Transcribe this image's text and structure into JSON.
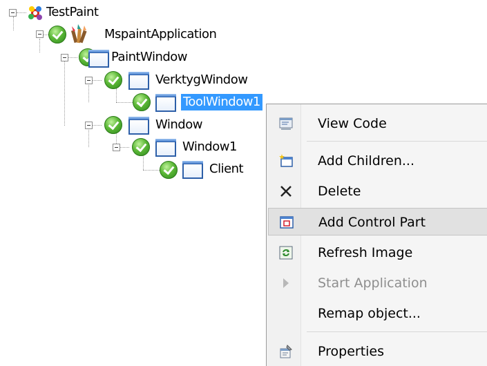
{
  "tree": {
    "root": "TestPaint",
    "app": "MspaintApplication",
    "paint_window": "PaintWindow",
    "verktyg_window": "VerktygWindow",
    "tool_window": "ToolWindow1",
    "window": "Window",
    "window1": "Window1",
    "client": "Client"
  },
  "menu": {
    "view_code": "View Code",
    "add_children": "Add Children...",
    "delete": "Delete",
    "add_control_part": "Add Control Part",
    "refresh_image": "Refresh Image",
    "start_application": "Start Application",
    "remap_object": "Remap object...",
    "properties": "Properties"
  },
  "colors": {
    "selection": "#3399ff",
    "menu_hover": "#e1e1e1",
    "check_green": "#5cb837",
    "window_blue": "#2d5fa8"
  },
  "icons": [
    "root-icon",
    "app-icon",
    "check-icon",
    "window-icon",
    "view-code-icon",
    "add-children-icon",
    "delete-icon",
    "add-control-part-icon",
    "refresh-image-icon",
    "start-application-icon",
    "properties-icon"
  ]
}
